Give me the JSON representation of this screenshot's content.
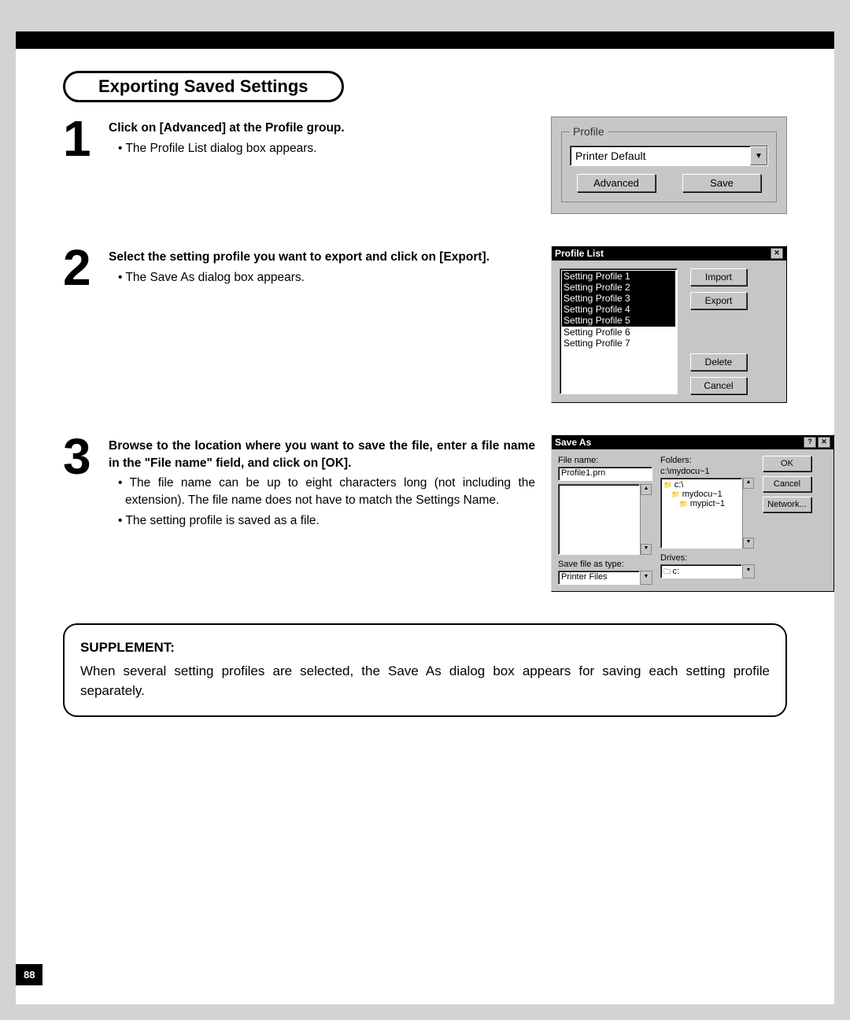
{
  "page_number": "88",
  "section_title": "Exporting Saved Settings",
  "steps": {
    "one": {
      "num": "1",
      "heading": "Click on [Advanced] at the Profile group.",
      "bullets": [
        "The Profile List dialog box appears."
      ]
    },
    "two": {
      "num": "2",
      "heading": "Select the setting profile you want to export and click on [Export].",
      "bullets": [
        "The Save As dialog box appears."
      ]
    },
    "three": {
      "num": "3",
      "heading": "Browse to the location where you want to save the file, enter a file name in the \"File name\" field, and click on [OK].",
      "bullets": [
        "The file name can be up to eight characters long (not including the extension).  The file name does not have to match the Settings Name.",
        "The setting profile is saved as a file."
      ]
    }
  },
  "supplement": {
    "title": "SUPPLEMENT:",
    "text": "When several setting profiles are selected, the Save As dialog box appears for saving each setting profile separately."
  },
  "dialogs": {
    "profile": {
      "legend": "Profile",
      "combo_value": "Printer Default",
      "btn_advanced": "Advanced",
      "btn_save": "Save"
    },
    "profile_list": {
      "title": "Profile List",
      "items": [
        "Setting Profile 1",
        "Setting Profile 2",
        "Setting Profile 3",
        "Setting Profile 4",
        "Setting Profile 5",
        "Setting Profile 6",
        "Setting Profile 7"
      ],
      "selected_indices": [
        0,
        1,
        2,
        3,
        4
      ],
      "btn_import": "Import",
      "btn_export": "Export",
      "btn_delete": "Delete",
      "btn_cancel": "Cancel"
    },
    "save_as": {
      "title": "Save As",
      "file_name_label": "File name:",
      "file_name_value": "Profile1.prn",
      "folders_label": "Folders:",
      "folders_path": "c:\\mydocu~1",
      "folders_tree": [
        "c:\\",
        "mydocu~1",
        "mypict~1"
      ],
      "save_type_label": "Save file as type:",
      "save_type_value": "Printer Files",
      "drives_label": "Drives:",
      "drives_value": "c:",
      "btn_ok": "OK",
      "btn_cancel": "Cancel",
      "btn_network": "Network..."
    }
  }
}
